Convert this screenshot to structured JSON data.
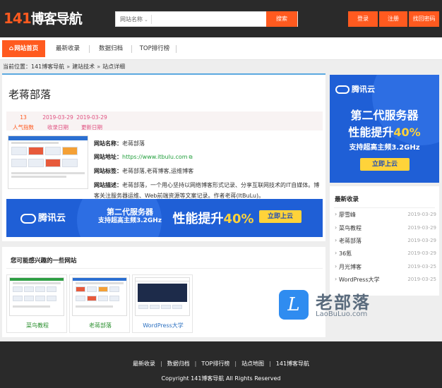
{
  "header": {
    "logo_num": "141",
    "logo_text": "博客导航",
    "search_select": "网站名称",
    "search_button": "搜索",
    "login": "登录",
    "register": "注册",
    "recover": "找回密码"
  },
  "nav": {
    "items": [
      {
        "label": "网站首页"
      },
      {
        "label": "最新收录"
      },
      {
        "label": "数据归档"
      },
      {
        "label": "TOP排行榜"
      }
    ]
  },
  "breadcrumb": {
    "prefix": "当前位置：",
    "items": [
      "141博客导航",
      "建站技术",
      "站点详细"
    ],
    "sep": "»"
  },
  "site": {
    "title": "老蒋部落",
    "stats": [
      {
        "value": "13",
        "label": "人气指数"
      },
      {
        "value": "2019-03-29",
        "label": "收录日期"
      },
      {
        "value": "2019-03-29",
        "label": "更新日期"
      }
    ],
    "name_label": "网站名称：",
    "name": "老蒋部落",
    "url_label": "网站地址：",
    "url": "https://www.itbulu.com",
    "tags_label": "网站标签：",
    "tags": "老蒋部落,老蒋博客,运维博客",
    "desc_label": "网站描述：",
    "desc": "老蒋部落，一个用心坚持以网络博客形式记录、分享互联网技术的IT自媒体。博客关注服务器运维、Web前端资源等文案记录。作者老蒋(ItBuLu)。"
  },
  "ad": {
    "brand": "腾讯云",
    "title_line": "第二代服务器",
    "perf_text": "性能提升",
    "perf_pct": "40%",
    "sub": "支持超高主频3.2GHz",
    "button": "立即上云"
  },
  "related": {
    "title": "您可能感兴趣的一些网站",
    "items": [
      {
        "name": "菜鸟教程"
      },
      {
        "name": "老蒋部落"
      },
      {
        "name": "WordPress大学"
      }
    ]
  },
  "recent": {
    "title": "最新收录",
    "items": [
      {
        "name": "廖雪峰",
        "date": "2019-03-29"
      },
      {
        "name": "菜鸟教程",
        "date": "2019-03-29"
      },
      {
        "name": "老蒋部落",
        "date": "2019-03-29"
      },
      {
        "name": "36氪",
        "date": "2019-03-29"
      },
      {
        "name": "月光博客",
        "date": "2019-03-25"
      },
      {
        "name": "WordPress大学",
        "date": "2019-03-25"
      }
    ]
  },
  "watermark": {
    "cn": "老部落",
    "en": "LaoBuLuo.com"
  },
  "footer": {
    "links": [
      "最新收录",
      "数据归档",
      "TOP排行榜",
      "站点地图",
      "141博客导航"
    ],
    "sep": "|",
    "copyright": "Copyright 141博客导航 All Rights Reserved"
  },
  "colors": {
    "accent": "#ff5a1f",
    "dark": "#2a2a2a",
    "ad_blue": "#1f5fd6",
    "ad_yellow": "#ffd33a",
    "link_green": "#2a8f2e"
  }
}
